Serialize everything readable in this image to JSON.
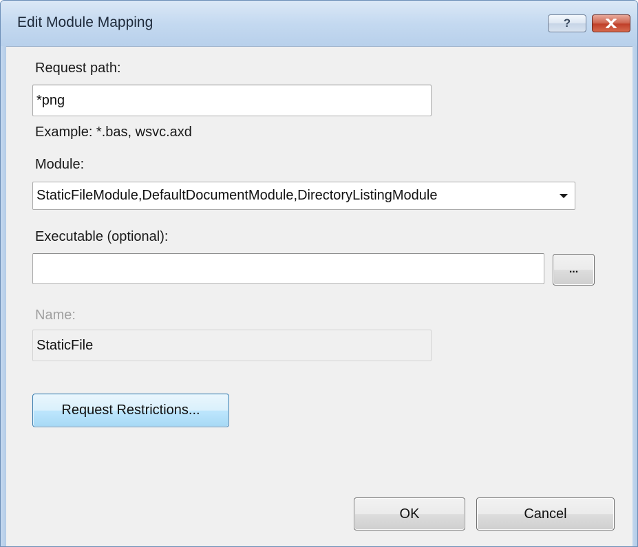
{
  "window": {
    "title": "Edit Module Mapping",
    "help_label": "?",
    "close_icon": "close-icon"
  },
  "form": {
    "request_path": {
      "label": "Request path:",
      "value": "*png",
      "example": "Example: *.bas, wsvc.axd"
    },
    "module": {
      "label": "Module:",
      "selected": "StaticFileModule,DefaultDocumentModule,DirectoryListingModule"
    },
    "executable": {
      "label": "Executable (optional):",
      "value": "",
      "browse_label": "..."
    },
    "name": {
      "label": "Name:",
      "value": "StaticFile"
    },
    "request_restrictions_label": "Request Restrictions..."
  },
  "buttons": {
    "ok_label": "OK",
    "cancel_label": "Cancel"
  },
  "colors": {
    "titlebar": "#c4d9f0",
    "close_button": "#c0402a",
    "focus_button": "#3c7fb1",
    "client_background": "#f0f0f0"
  }
}
